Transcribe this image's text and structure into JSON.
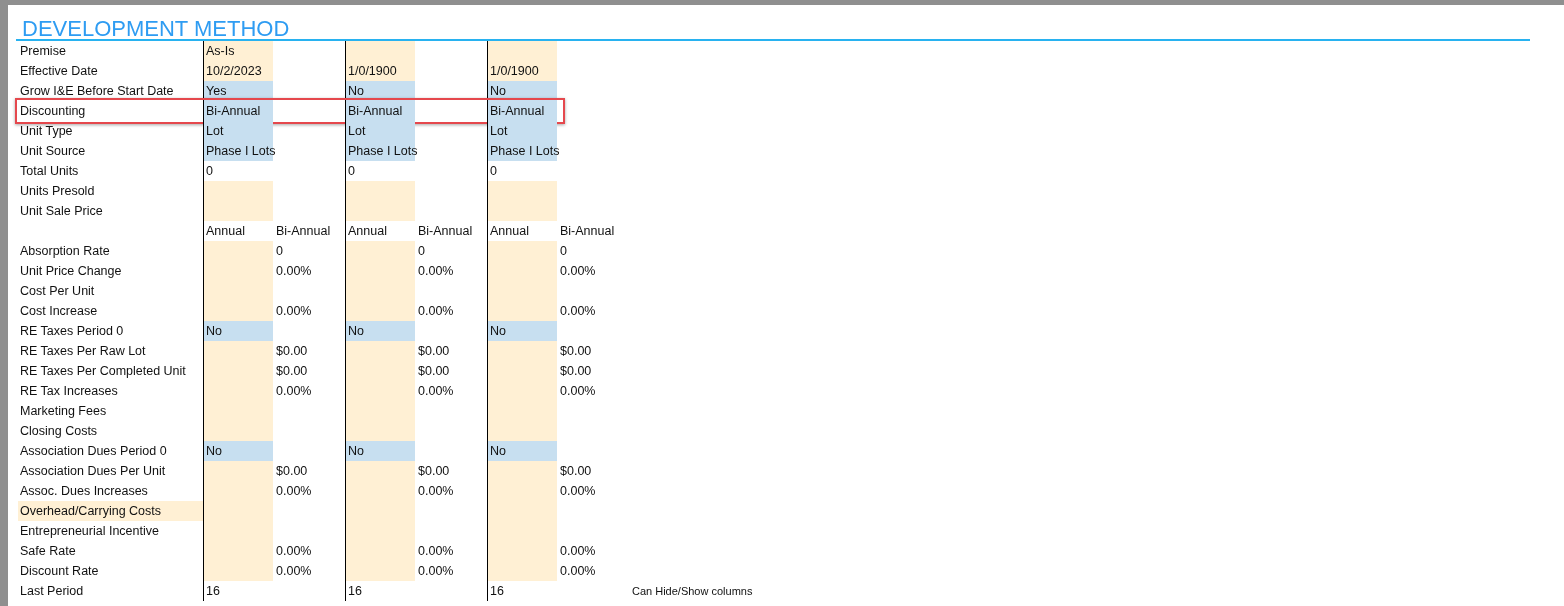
{
  "title": "DEVELOPMENT METHOD",
  "rows": [
    {
      "label": "Premise",
      "label_shaded": false,
      "highlighted": false,
      "groups": [
        {
          "kind": "input",
          "a": "As-Is"
        },
        {
          "kind": "input"
        },
        {
          "kind": "input"
        }
      ]
    },
    {
      "label": "Effective Date",
      "label_shaded": false,
      "highlighted": false,
      "groups": [
        {
          "kind": "input",
          "a": "10/2/2023"
        },
        {
          "kind": "input",
          "a": "1/0/1900"
        },
        {
          "kind": "input",
          "a": "1/0/1900"
        }
      ]
    },
    {
      "label": "Grow I&E Before Start Date",
      "label_shaded": false,
      "highlighted": false,
      "groups": [
        {
          "kind": "choice",
          "a": "Yes"
        },
        {
          "kind": "choice",
          "a": "No"
        },
        {
          "kind": "choice",
          "a": "No"
        }
      ]
    },
    {
      "label": "Discounting",
      "label_shaded": false,
      "highlighted": true,
      "groups": [
        {
          "kind": "choice",
          "a": "Bi-Annual"
        },
        {
          "kind": "choice",
          "a": "Bi-Annual"
        },
        {
          "kind": "choice",
          "a": "Bi-Annual"
        }
      ]
    },
    {
      "label": "Unit Type",
      "label_shaded": false,
      "highlighted": false,
      "groups": [
        {
          "kind": "choice",
          "a": "Lot"
        },
        {
          "kind": "choice",
          "a": "Lot"
        },
        {
          "kind": "choice",
          "a": "Lot"
        }
      ]
    },
    {
      "label": "Unit Source",
      "label_shaded": false,
      "highlighted": false,
      "groups": [
        {
          "kind": "choice",
          "a": "Phase I Lots"
        },
        {
          "kind": "choice",
          "a": "Phase I Lots"
        },
        {
          "kind": "choice",
          "a": "Phase I Lots"
        }
      ]
    },
    {
      "label": "Total Units",
      "label_shaded": false,
      "highlighted": false,
      "groups": [
        {
          "kind": "plain",
          "a": "0"
        },
        {
          "kind": "plain",
          "a": "0"
        },
        {
          "kind": "plain",
          "a": "0"
        }
      ]
    },
    {
      "label": "Units Presold",
      "label_shaded": false,
      "highlighted": false,
      "groups": [
        {
          "kind": "input"
        },
        {
          "kind": "input"
        },
        {
          "kind": "input"
        }
      ]
    },
    {
      "label": "Unit Sale Price",
      "label_shaded": false,
      "highlighted": false,
      "groups": [
        {
          "kind": "input"
        },
        {
          "kind": "input"
        },
        {
          "kind": "input"
        }
      ]
    },
    {
      "label_shaded": false,
      "highlighted": false,
      "groups": [
        {
          "kind": "plain",
          "a": "Annual",
          "b": "Bi-Annual"
        },
        {
          "kind": "plain",
          "a": "Annual",
          "b": "Bi-Annual"
        },
        {
          "kind": "plain",
          "a": "Annual",
          "b": "Bi-Annual"
        }
      ]
    },
    {
      "label": "Absorption Rate",
      "label_shaded": false,
      "highlighted": false,
      "groups": [
        {
          "kind": "input",
          "b": "0"
        },
        {
          "kind": "input",
          "b": "0"
        },
        {
          "kind": "input",
          "b": "0"
        }
      ]
    },
    {
      "label": "Unit Price Change",
      "label_shaded": false,
      "highlighted": false,
      "groups": [
        {
          "kind": "input",
          "b": "0.00%"
        },
        {
          "kind": "input",
          "b": "0.00%"
        },
        {
          "kind": "input",
          "b": "0.00%"
        }
      ]
    },
    {
      "label": "Cost Per Unit",
      "label_shaded": false,
      "highlighted": false,
      "groups": [
        {
          "kind": "input"
        },
        {
          "kind": "input"
        },
        {
          "kind": "input"
        }
      ]
    },
    {
      "label": "Cost Increase",
      "label_shaded": false,
      "highlighted": false,
      "groups": [
        {
          "kind": "input",
          "b": "0.00%"
        },
        {
          "kind": "input",
          "b": "0.00%"
        },
        {
          "kind": "input",
          "b": "0.00%"
        }
      ]
    },
    {
      "label": "RE Taxes Period 0",
      "label_shaded": false,
      "highlighted": false,
      "groups": [
        {
          "kind": "choice",
          "a": "No"
        },
        {
          "kind": "choice",
          "a": "No"
        },
        {
          "kind": "choice",
          "a": "No"
        }
      ]
    },
    {
      "label": "RE Taxes Per Raw Lot",
      "label_shaded": false,
      "highlighted": false,
      "groups": [
        {
          "kind": "input",
          "b": "$0.00"
        },
        {
          "kind": "input",
          "b": "$0.00"
        },
        {
          "kind": "input",
          "b": "$0.00"
        }
      ]
    },
    {
      "label": "RE Taxes Per Completed Unit",
      "label_shaded": false,
      "highlighted": false,
      "groups": [
        {
          "kind": "input",
          "b": "$0.00"
        },
        {
          "kind": "input",
          "b": "$0.00"
        },
        {
          "kind": "input",
          "b": "$0.00"
        }
      ]
    },
    {
      "label": "RE Tax Increases",
      "label_shaded": false,
      "highlighted": false,
      "groups": [
        {
          "kind": "input",
          "b": "0.00%"
        },
        {
          "kind": "input",
          "b": "0.00%"
        },
        {
          "kind": "input",
          "b": "0.00%"
        }
      ]
    },
    {
      "label": "Marketing Fees",
      "label_shaded": false,
      "highlighted": false,
      "groups": [
        {
          "kind": "input"
        },
        {
          "kind": "input"
        },
        {
          "kind": "input"
        }
      ]
    },
    {
      "label": "Closing Costs",
      "label_shaded": false,
      "highlighted": false,
      "groups": [
        {
          "kind": "input"
        },
        {
          "kind": "input"
        },
        {
          "kind": "input"
        }
      ]
    },
    {
      "label": "Association Dues Period 0",
      "label_shaded": false,
      "highlighted": false,
      "groups": [
        {
          "kind": "choice",
          "a": "No"
        },
        {
          "kind": "choice",
          "a": "No"
        },
        {
          "kind": "choice",
          "a": "No"
        }
      ]
    },
    {
      "label": "Association Dues Per Unit",
      "label_shaded": false,
      "highlighted": false,
      "groups": [
        {
          "kind": "input",
          "b": "$0.00"
        },
        {
          "kind": "input",
          "b": "$0.00"
        },
        {
          "kind": "input",
          "b": "$0.00"
        }
      ]
    },
    {
      "label": "Assoc. Dues Increases",
      "label_shaded": false,
      "highlighted": false,
      "groups": [
        {
          "kind": "input",
          "b": "0.00%"
        },
        {
          "kind": "input",
          "b": "0.00%"
        },
        {
          "kind": "input",
          "b": "0.00%"
        }
      ]
    },
    {
      "label": "Overhead/Carrying Costs",
      "label_shaded": true,
      "highlighted": false,
      "groups": [
        {
          "kind": "input"
        },
        {
          "kind": "input"
        },
        {
          "kind": "input"
        }
      ]
    },
    {
      "label": "Entrepreneurial Incentive",
      "label_shaded": false,
      "highlighted": false,
      "groups": [
        {
          "kind": "input"
        },
        {
          "kind": "input"
        },
        {
          "kind": "input"
        }
      ]
    },
    {
      "label": "Safe Rate",
      "label_shaded": false,
      "highlighted": false,
      "groups": [
        {
          "kind": "input",
          "b": "0.00%"
        },
        {
          "kind": "input",
          "b": "0.00%"
        },
        {
          "kind": "input",
          "b": "0.00%"
        }
      ]
    },
    {
      "label": "Discount Rate",
      "label_shaded": false,
      "highlighted": false,
      "groups": [
        {
          "kind": "input",
          "b": "0.00%"
        },
        {
          "kind": "input",
          "b": "0.00%"
        },
        {
          "kind": "input",
          "b": "0.00%"
        }
      ]
    },
    {
      "label": "Last Period",
      "label_shaded": false,
      "highlighted": false,
      "note": "Can Hide/Show columns",
      "groups": [
        {
          "kind": "plain",
          "a": "16"
        },
        {
          "kind": "plain",
          "a": "16"
        },
        {
          "kind": "plain",
          "a": "16"
        }
      ]
    }
  ]
}
